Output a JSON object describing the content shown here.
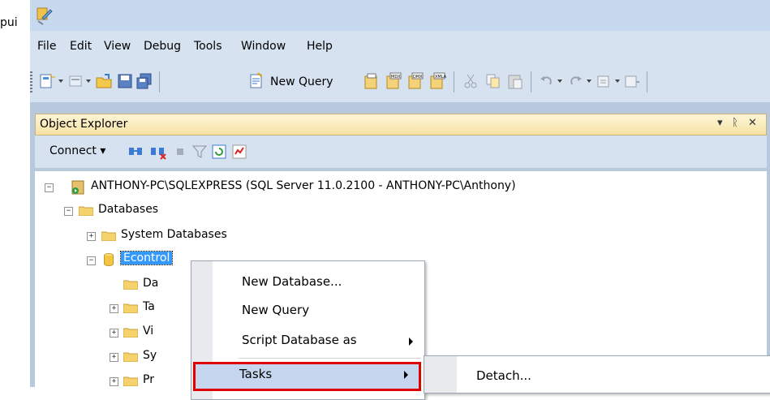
{
  "outside_text": "pui",
  "menubar": {
    "items": [
      "File",
      "Edit",
      "View",
      "Debug",
      "Tools",
      "Window",
      "Help"
    ]
  },
  "toolbar": {
    "new_query_label": "New Query"
  },
  "object_explorer": {
    "title": "Object Explorer",
    "controls": {
      "dropdown": "▾",
      "pin": "ᚱ",
      "close": "✕"
    },
    "connect_label": "Connect ▾"
  },
  "tree": {
    "server": "ANTHONY-PC\\SQLEXPRESS (SQL Server 11.0.2100 - ANTHONY-PC\\Anthony)",
    "databases": "Databases",
    "system_databases": "System Databases",
    "econtrol": "Econtrol",
    "child_prefixes": [
      "Da",
      "Ta",
      "Vi",
      "Sy",
      "Pr"
    ]
  },
  "context_menu": {
    "items": [
      {
        "label": "New Database..."
      },
      {
        "label": "New Query"
      },
      {
        "label": "Script Database as"
      },
      {
        "label": "Tasks"
      }
    ]
  },
  "submenu": {
    "items": [
      {
        "label": "Detach..."
      }
    ]
  },
  "colors": {
    "highlight_border": "#e00000",
    "chrome": "#d6e2f0",
    "selected_node": "#3399ff"
  }
}
